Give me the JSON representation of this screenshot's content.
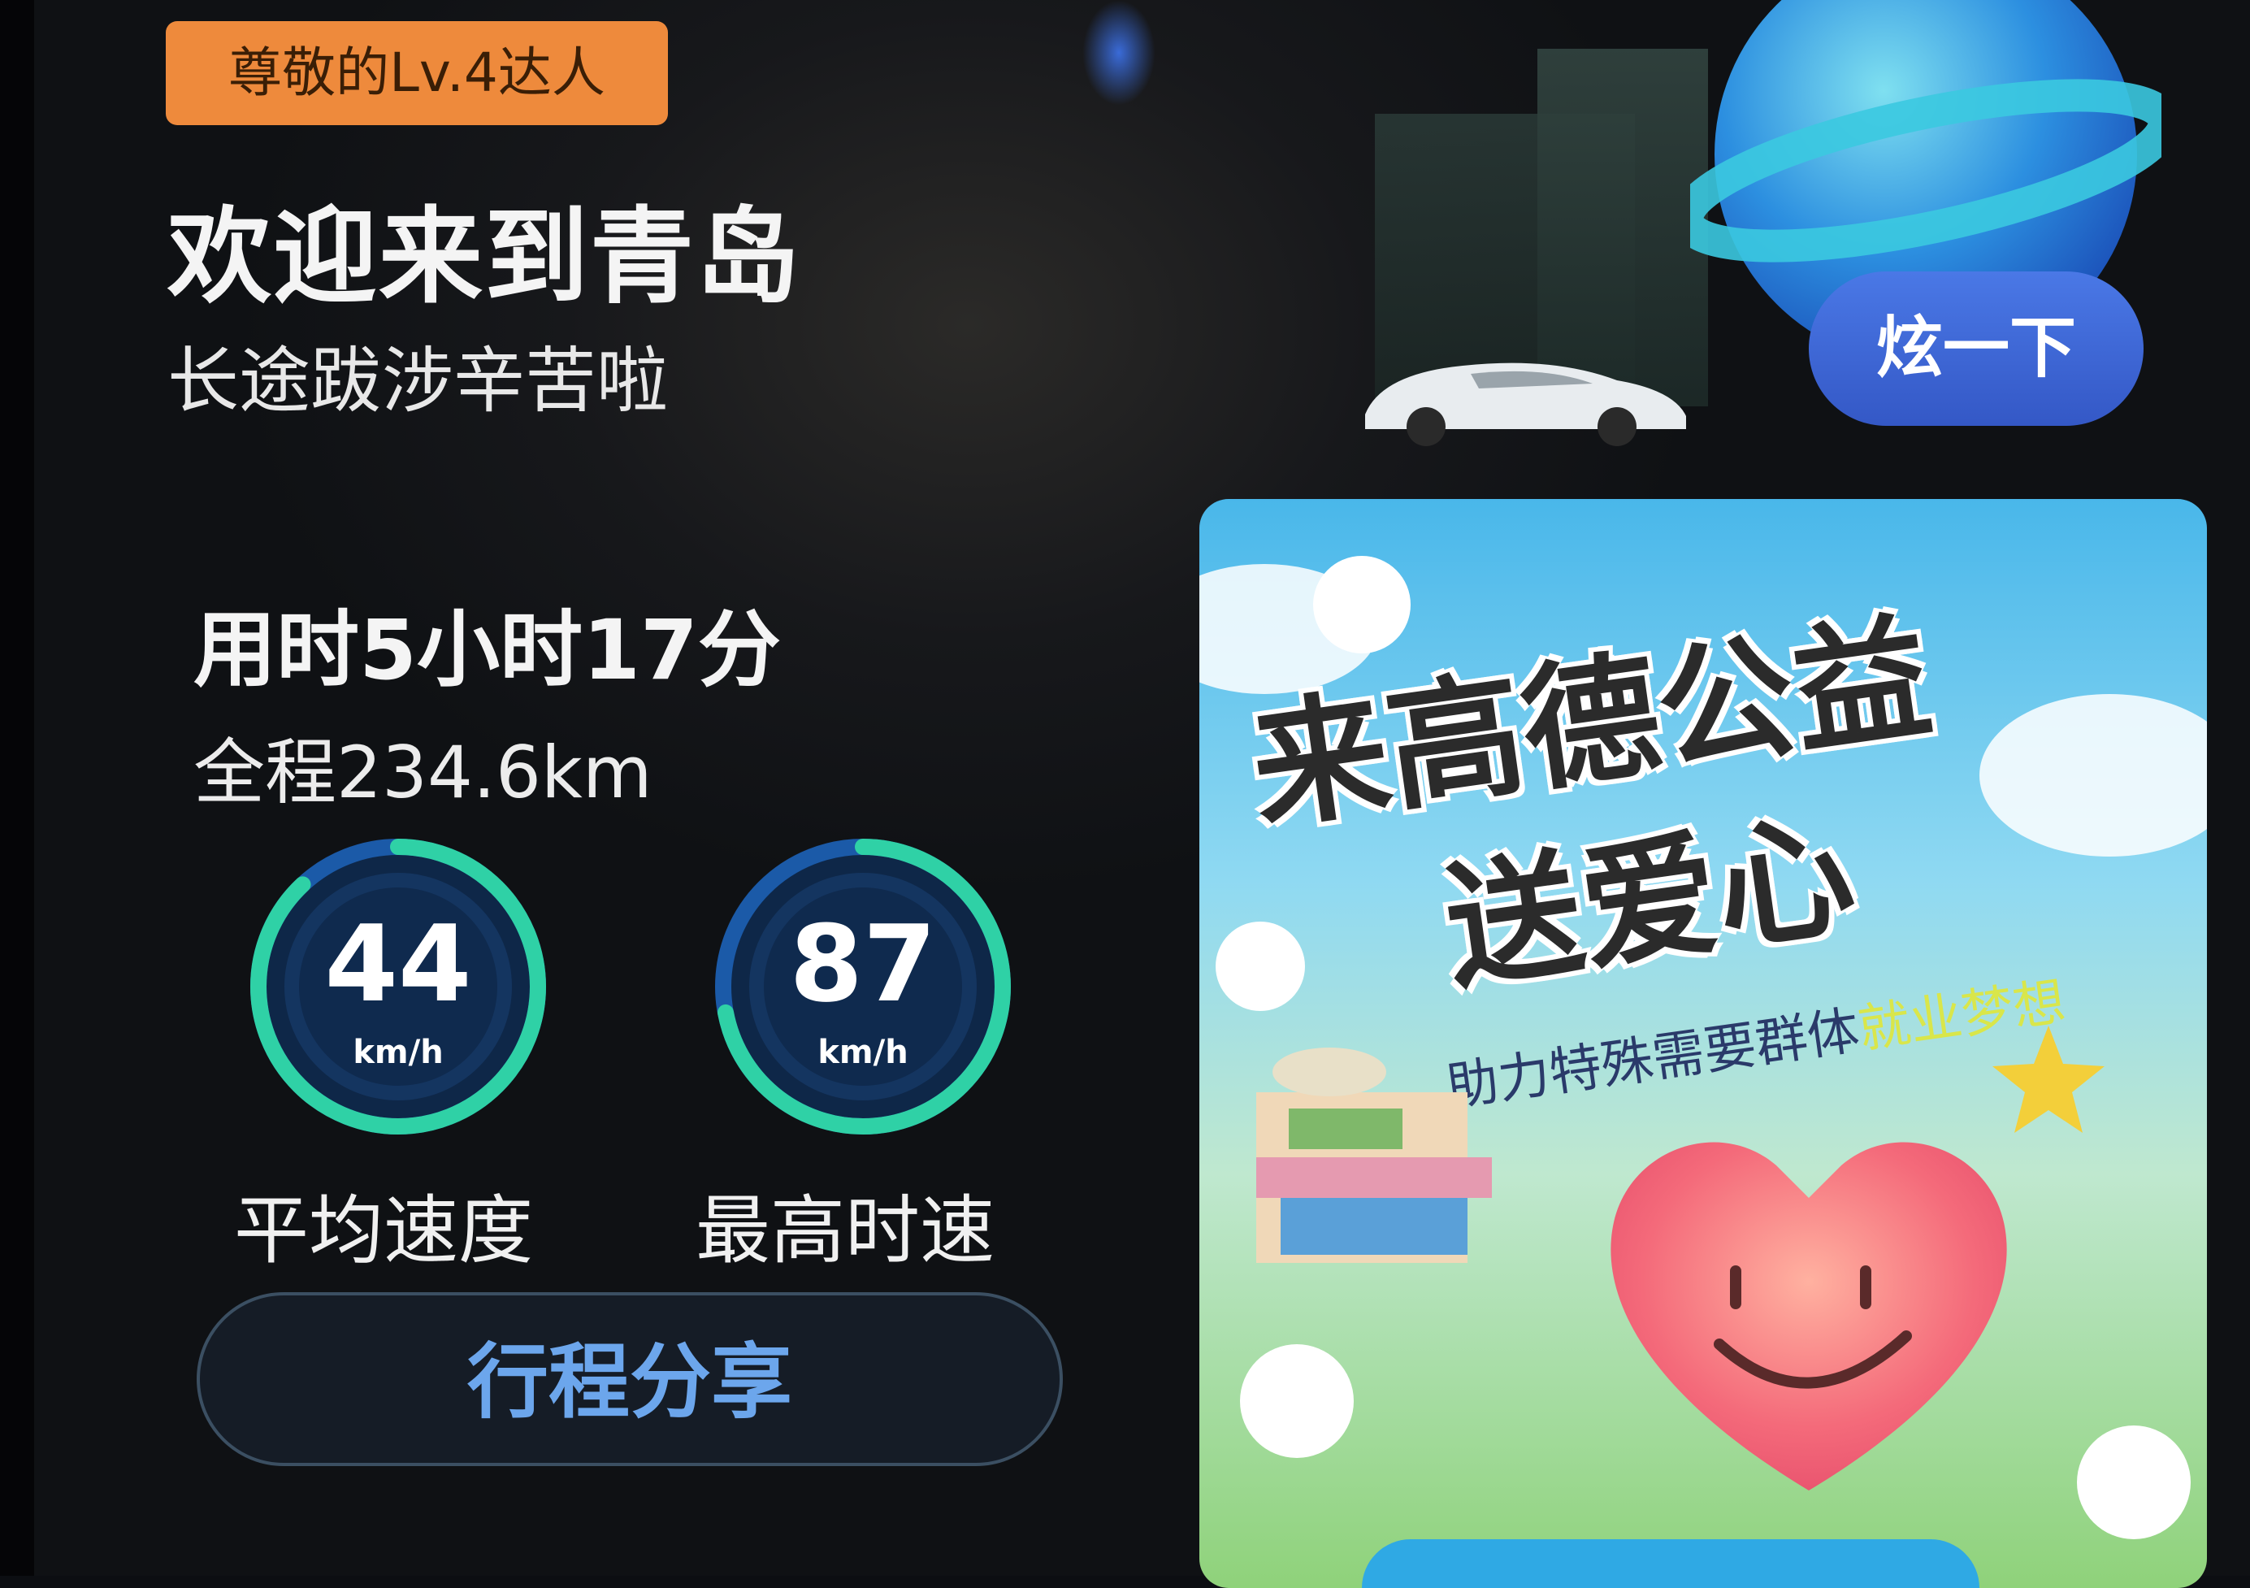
{
  "level_badge": "尊敬的Lv.4达人",
  "welcome": {
    "title": "欢迎来到青岛",
    "subtitle": "长途跋涉辛苦啦"
  },
  "trip": {
    "duration": "用时5小时17分",
    "distance": "全程234.6km"
  },
  "gauges": [
    {
      "value": "44",
      "unit": "km/h",
      "label": "平均速度",
      "fill": 0.88
    },
    {
      "value": "87",
      "unit": "km/h",
      "label": "最高时速",
      "fill": 0.72
    }
  ],
  "share_button": "行程分享",
  "show_off_button": "炫一下",
  "banner": {
    "title_line1": "来高德公益",
    "title_line2": "送爱心",
    "subtitle": "助力特殊需要群体",
    "subtitle_highlight": "就业梦想"
  },
  "colors": {
    "badge": "#ee8a3c",
    "gauge_track": "#1d4f9a",
    "gauge_arc": "#2fd1a6",
    "share_text": "#6ca6ec",
    "show_off_button": "#4a78e6"
  }
}
